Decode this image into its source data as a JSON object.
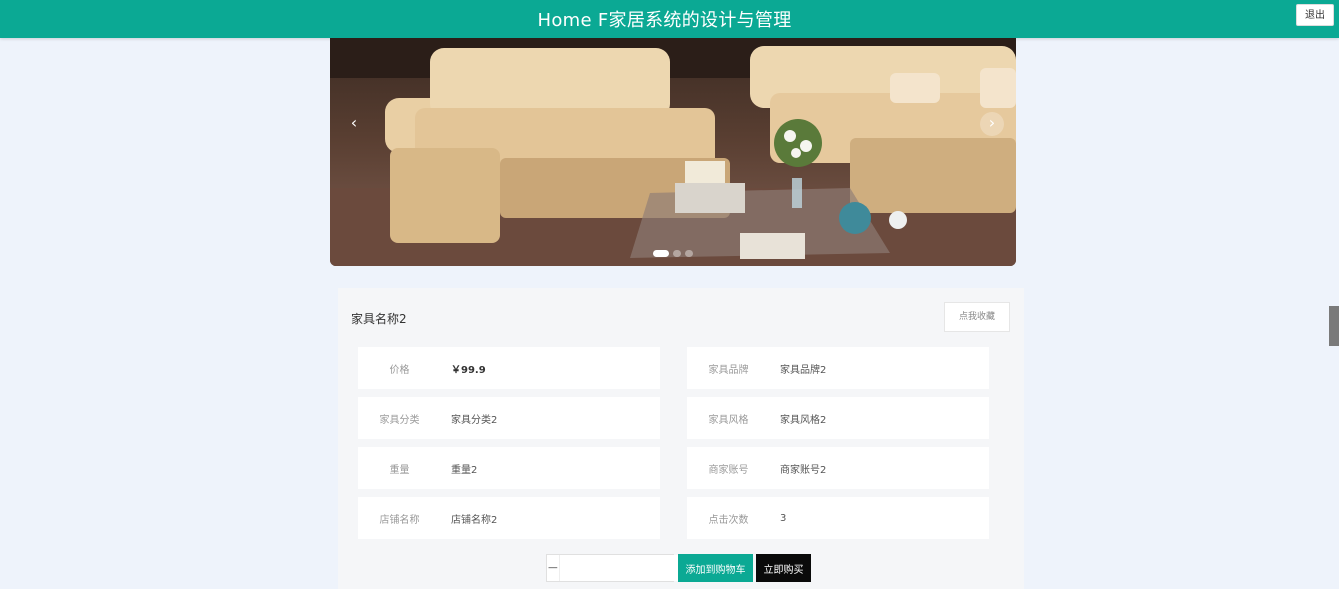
{
  "header": {
    "title": "Home F家居系统的设计与管理",
    "logout": "退出"
  },
  "carousel": {
    "prev": "‹",
    "next": "›",
    "slides": 3,
    "active_slide": 0
  },
  "product": {
    "name": "家具名称2",
    "favorite_label": "点我收藏",
    "fields": [
      {
        "label": "价格",
        "value": "￥99.9"
      },
      {
        "label": "家具品牌",
        "value": "家具品牌2"
      },
      {
        "label": "家具分类",
        "value": "家具分类2"
      },
      {
        "label": "家具风格",
        "value": "家具风格2"
      },
      {
        "label": "重量",
        "value": "重量2"
      },
      {
        "label": "商家账号",
        "value": "商家账号2"
      },
      {
        "label": "店铺名称",
        "value": "店铺名称2"
      },
      {
        "label": "点击次数",
        "value": "3"
      }
    ]
  },
  "actions": {
    "minus": "−",
    "plus": "+",
    "quantity": "",
    "add_to_cart": "添加到购物车",
    "buy_now": "立即购买"
  }
}
